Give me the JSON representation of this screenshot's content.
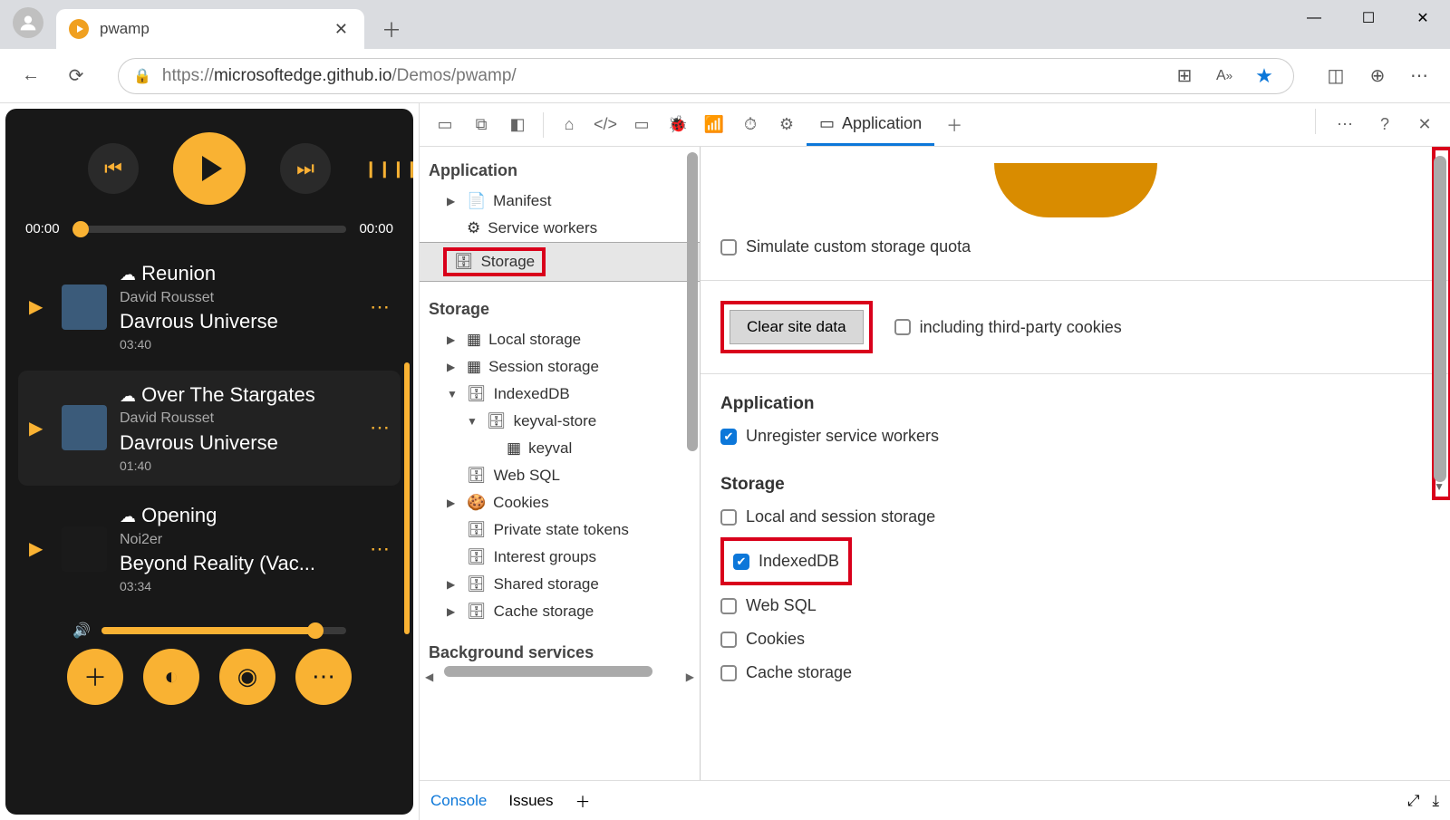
{
  "browser": {
    "tab_title": "pwamp",
    "url_prefix": "https://",
    "url_host": "microsoftedge.github.io",
    "url_path": "/Demos/pwamp/"
  },
  "player": {
    "time_current": "00:00",
    "time_total": "00:00",
    "tracks": [
      {
        "subtitle_icon": "☁",
        "subtitle": "Reunion",
        "artist": "David Rousset",
        "album": "Davrous Universe",
        "duration": "03:40"
      },
      {
        "subtitle_icon": "☁",
        "subtitle": "Over The Stargates",
        "artist": "David Rousset",
        "album": "Davrous Universe",
        "duration": "01:40"
      },
      {
        "subtitle_icon": "☁",
        "subtitle": "Opening",
        "artist": "Noi2er",
        "album": "Beyond Reality (Vac...",
        "duration": "03:34"
      }
    ]
  },
  "devtools": {
    "active_tab": "Application",
    "sidebar": {
      "sections": {
        "application": {
          "label": "Application",
          "items": [
            "Manifest",
            "Service workers",
            "Storage"
          ]
        },
        "storage": {
          "label": "Storage",
          "items": [
            "Local storage",
            "Session storage",
            "IndexedDB",
            "Web SQL",
            "Cookies",
            "Private state tokens",
            "Interest groups",
            "Shared storage",
            "Cache storage"
          ],
          "indexeddb_children": {
            "store": "keyval-store",
            "table": "keyval"
          }
        },
        "background": {
          "label": "Background services"
        }
      }
    },
    "main": {
      "simulate_quota": "Simulate custom storage quota",
      "clear_button": "Clear site data",
      "third_party": "including third-party cookies",
      "app_section": "Application",
      "unregister_sw": "Unregister service workers",
      "storage_section": "Storage",
      "storage_checks": [
        {
          "label": "Local and session storage",
          "checked": false
        },
        {
          "label": "IndexedDB",
          "checked": true,
          "highlight": true
        },
        {
          "label": "Web SQL",
          "checked": false
        },
        {
          "label": "Cookies",
          "checked": false
        },
        {
          "label": "Cache storage",
          "checked": false
        }
      ]
    },
    "drawer": {
      "console": "Console",
      "issues": "Issues"
    }
  }
}
